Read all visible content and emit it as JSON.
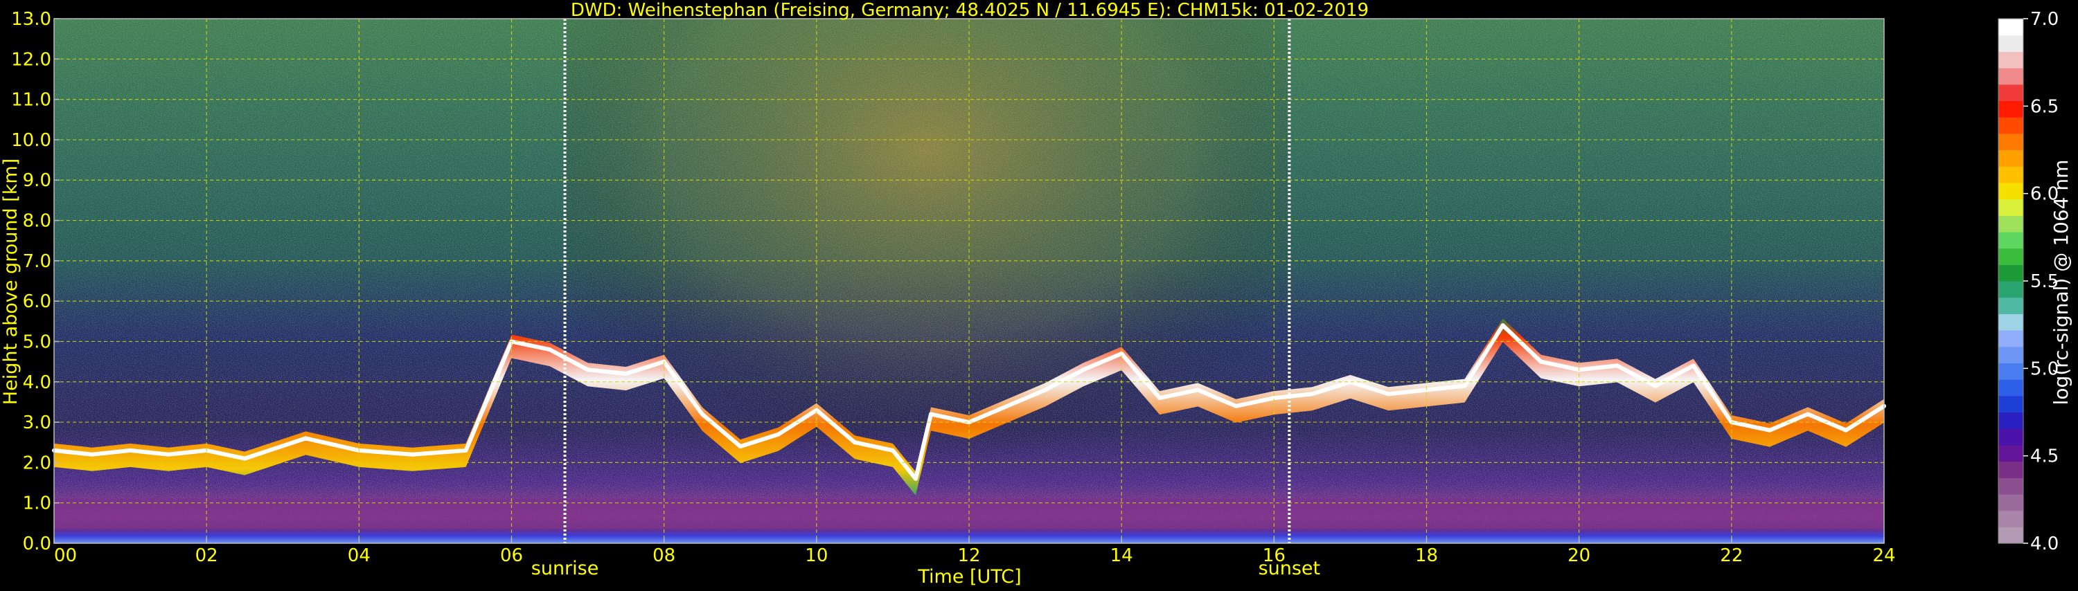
{
  "chart_data": {
    "type": "heatmap",
    "title": "DWD: Weihenstephan (Freising, Germany; 48.4025 N / 11.6945 E):    CHM15k: 01-02-2019",
    "xlabel": "Time [UTC]",
    "ylabel": "Height above ground [km]",
    "xlim": [
      0,
      24
    ],
    "ylim": [
      0,
      13
    ],
    "x_ticks": [
      "00",
      "02",
      "04",
      "06",
      "08",
      "10",
      "12",
      "14",
      "16",
      "18",
      "20",
      "22",
      "24"
    ],
    "y_ticks": [
      "0.0",
      "1.0",
      "2.0",
      "3.0",
      "4.0",
      "5.0",
      "6.0",
      "7.0",
      "8.0",
      "9.0",
      "10.0",
      "11.0",
      "12.0",
      "13.0"
    ],
    "grid": true,
    "colorbar": {
      "label": "log(rc-signal) @ 1064 nm",
      "range": [
        4.0,
        7.0
      ],
      "ticks": [
        "4.0",
        "4.5",
        "5.0",
        "5.5",
        "6.0",
        "6.5",
        "7.0"
      ],
      "colors": [
        "#b49bb4",
        "#a985a9",
        "#9b6b9b",
        "#8b4e8e",
        "#7a2f86",
        "#63159a",
        "#4a12a8",
        "#2a1fbf",
        "#1e3fd6",
        "#2e5fe8",
        "#4a7df0",
        "#6e96f5",
        "#8fadf8",
        "#9fd3e6",
        "#4fb9a4",
        "#2aa46e",
        "#1e9a38",
        "#3bbd3b",
        "#5fd65f",
        "#9ee05a",
        "#d9f03a",
        "#f5e000",
        "#ffc000",
        "#ffa000",
        "#ff7a00",
        "#ff4a00",
        "#ff1a00",
        "#f23c3c",
        "#f08a8a",
        "#f3c0c0",
        "#ececec",
        "#ffffff"
      ]
    },
    "events": [
      {
        "label": "sunrise",
        "time": 6.7
      },
      {
        "label": "sunset",
        "time": 16.2
      }
    ],
    "series": [
      {
        "x": [
          0,
          0.5,
          1,
          1.5,
          2,
          2.5,
          3.3,
          4,
          4.7,
          5.4,
          6,
          6.5,
          7,
          7.5,
          8,
          8.5,
          9,
          9.5,
          10,
          10.5,
          11,
          11.3,
          11.5,
          12,
          12.5,
          13,
          13.5,
          14,
          14.5,
          15,
          15.5,
          16,
          16.5,
          17,
          17.5,
          18,
          18.5,
          19,
          19.5,
          20,
          20.5,
          21,
          21.5,
          22,
          22.5,
          23,
          23.5,
          24
        ],
        "y": [
          2.3,
          2.2,
          2.3,
          2.2,
          2.3,
          2.1,
          2.6,
          2.3,
          2.2,
          2.3,
          5.0,
          4.8,
          4.3,
          4.2,
          4.5,
          3.2,
          2.4,
          2.7,
          3.3,
          2.5,
          2.3,
          1.6,
          3.2,
          3.0,
          3.4,
          3.8,
          4.3,
          4.7,
          3.6,
          3.8,
          3.4,
          3.6,
          3.7,
          4.0,
          3.7,
          3.8,
          3.9,
          5.4,
          4.5,
          4.3,
          4.4,
          3.9,
          4.4,
          3.0,
          2.8,
          3.2,
          2.8,
          3.4
        ]
      }
    ]
  }
}
